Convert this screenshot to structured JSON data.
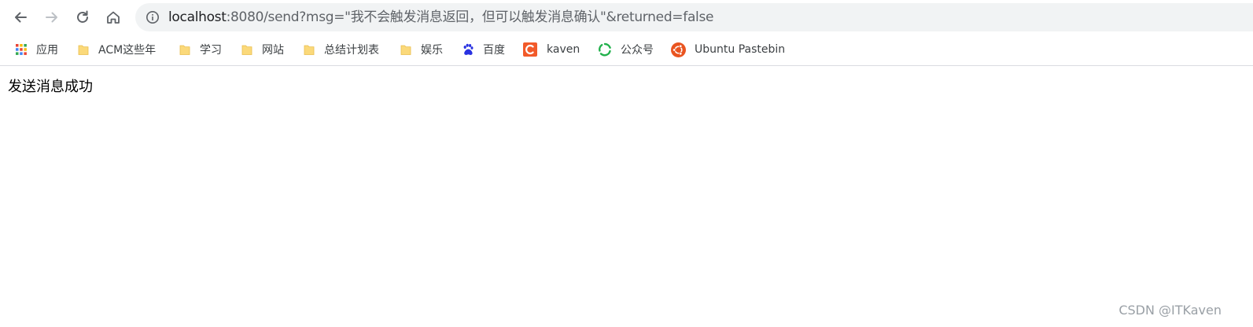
{
  "browser": {
    "url_host": "localhost",
    "url_rest": ":8080/send?msg=\"我不会触发消息返回，但可以触发消息确认\"&returned=false"
  },
  "bookmarks": [
    {
      "label": "应用",
      "icon": "apps-grid-icon"
    },
    {
      "label": "ACM这些年",
      "icon": "folder-icon"
    },
    {
      "label": "学习",
      "icon": "folder-icon"
    },
    {
      "label": "网站",
      "icon": "folder-icon"
    },
    {
      "label": "总结计划表",
      "icon": "folder-icon"
    },
    {
      "label": "娱乐",
      "icon": "folder-icon"
    },
    {
      "label": "百度",
      "icon": "baidu-paw-icon"
    },
    {
      "label": "kaven",
      "icon": "csdn-c-icon"
    },
    {
      "label": "公众号",
      "icon": "wechat-mp-icon"
    },
    {
      "label": "Ubuntu Pastebin",
      "icon": "ubuntu-icon"
    }
  ],
  "page": {
    "message": "发送消息成功"
  },
  "watermark": "CSDN @ITKaven",
  "colors": {
    "folder": "#fbd97a",
    "csdn": "#f25a2a",
    "ubuntu": "#e95420",
    "wechat_mp": "#22b14c",
    "baidu": "#2932e1"
  }
}
